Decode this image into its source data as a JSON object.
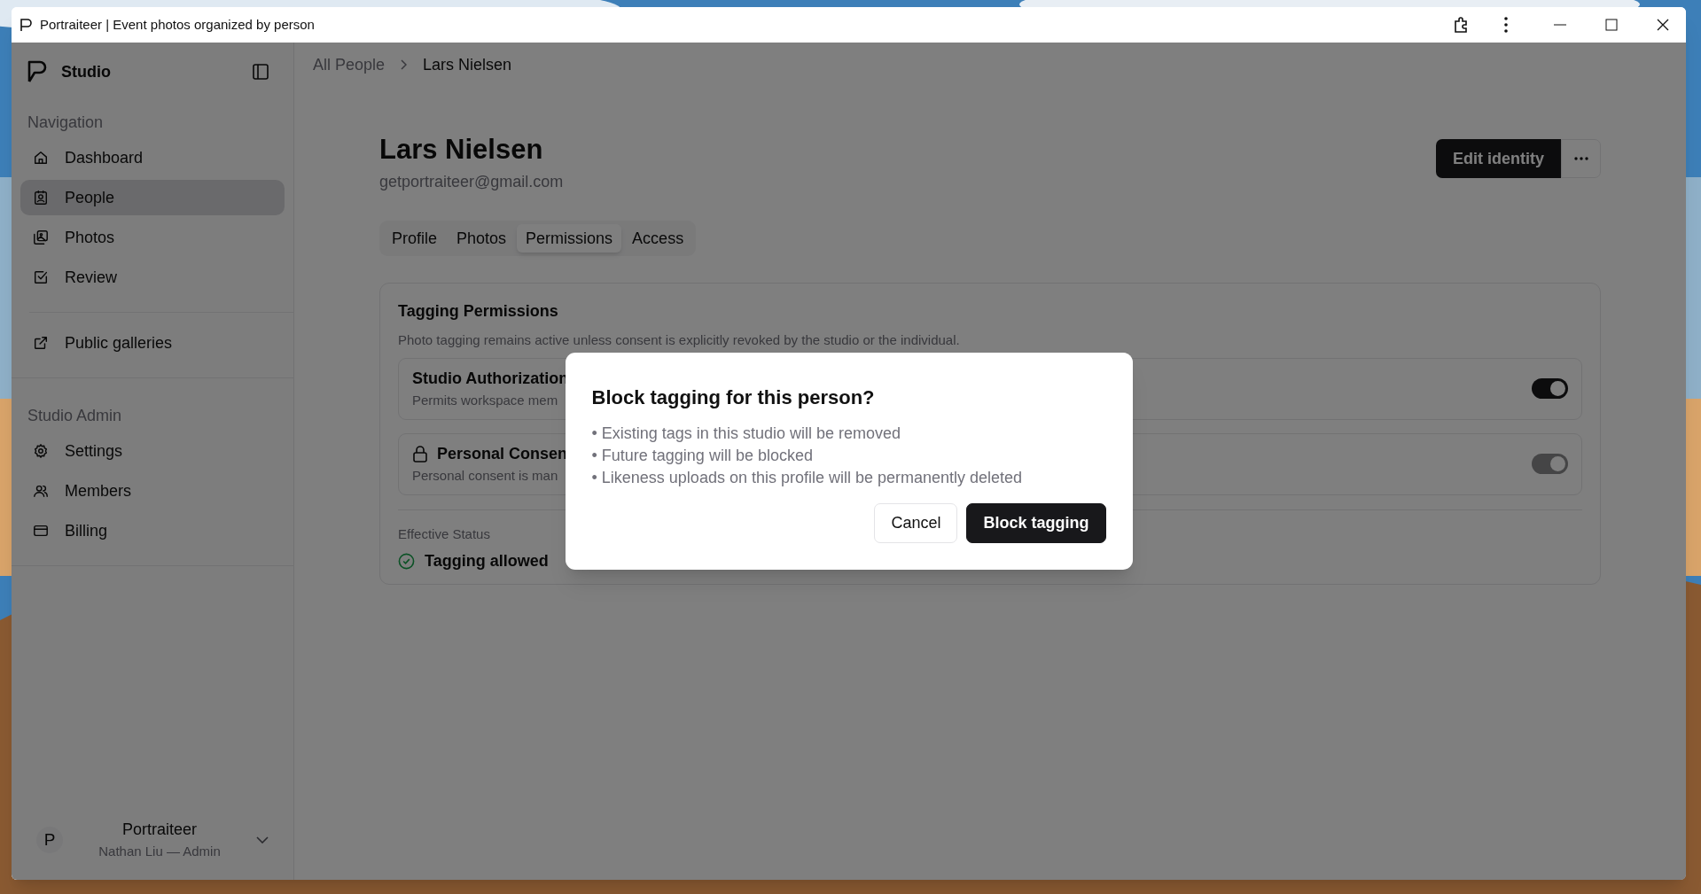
{
  "window": {
    "title": "Portraiteer | Event photos organized by person"
  },
  "sidebar": {
    "brand": "Studio",
    "sections": [
      {
        "heading": "Navigation",
        "items": [
          {
            "label": "Dashboard",
            "selected": false
          },
          {
            "label": "People",
            "selected": true
          },
          {
            "label": "Photos",
            "selected": false
          },
          {
            "label": "Review",
            "selected": false
          }
        ]
      },
      {
        "items": [
          {
            "label": "Public galleries",
            "selected": false
          }
        ]
      },
      {
        "heading": "Studio Admin",
        "items": [
          {
            "label": "Settings",
            "selected": false
          },
          {
            "label": "Members",
            "selected": false
          },
          {
            "label": "Billing",
            "selected": false
          }
        ]
      }
    ],
    "account": {
      "avatar": "P",
      "name": "Portraiteer",
      "subtitle": "Nathan Liu — Admin"
    }
  },
  "breadcrumb": [
    "All People",
    "Lars Nielsen"
  ],
  "header": {
    "name": "Lars Nielsen",
    "email": "getportraiteer@gmail.com",
    "primary_button": "Edit identity"
  },
  "tabs": [
    {
      "label": "Profile",
      "selected": false
    },
    {
      "label": "Photos",
      "selected": false
    },
    {
      "label": "Permissions",
      "selected": true
    },
    {
      "label": "Access",
      "selected": false
    }
  ],
  "card": {
    "title": "Tagging Permissions",
    "description": "Photo tagging remains active unless consent is explicitly revoked by the studio or the individual.",
    "rows": [
      {
        "title": "Studio Authorization",
        "subtitle": "Permits workspace mem",
        "locked": false,
        "on": true,
        "disabled": false
      },
      {
        "title": "Personal Consen",
        "subtitle": "Personal consent is man",
        "locked": true,
        "on": true,
        "disabled": true
      }
    ],
    "status_label": "Effective Status",
    "status": "Tagging allowed"
  },
  "dialog": {
    "title": "Block tagging for this person?",
    "bullets": [
      "• Existing tags in this studio will be removed",
      "• Future tagging will be blocked",
      "• Likeness uploads on this profile will be permanently deleted"
    ],
    "buttons": [
      {
        "label": "Cancel",
        "kind": "secondary"
      },
      {
        "label": "Block tagging",
        "kind": "primary"
      }
    ]
  }
}
